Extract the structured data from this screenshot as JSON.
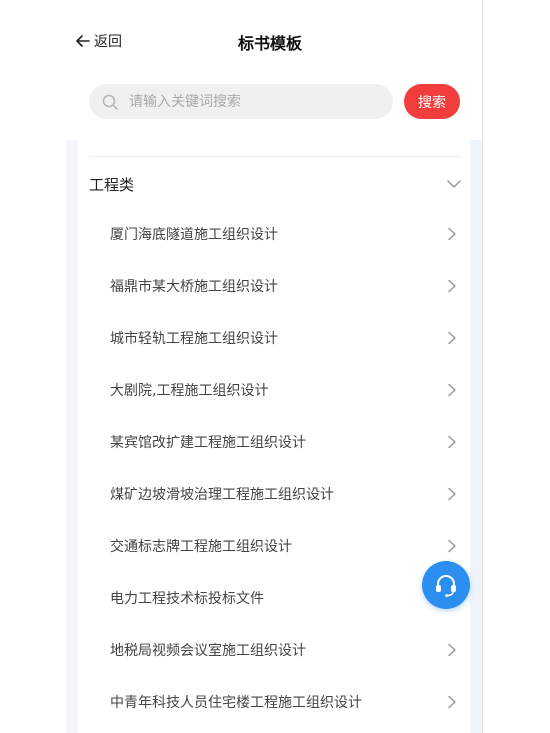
{
  "header": {
    "back_label": "返回",
    "title": "标书模板"
  },
  "search": {
    "placeholder": "请输入关键词搜索",
    "button_label": "搜索"
  },
  "category": {
    "label": "工程类"
  },
  "items": [
    {
      "label": "厦门海底隧道施工组织设计"
    },
    {
      "label": "福鼎市某大桥施工组织设计"
    },
    {
      "label": "城市轻轨工程施工组织设计"
    },
    {
      "label": "大剧院,工程施工组织设计"
    },
    {
      "label": "某宾馆改扩建工程施工组织设计"
    },
    {
      "label": "煤矿边坡滑坡治理工程施工组织设计"
    },
    {
      "label": "交通标志牌工程施工组织设计"
    },
    {
      "label": "电力工程技术标投标文件"
    },
    {
      "label": "地税局视频会议室施工组织设计"
    },
    {
      "label": "中青年科技人员住宅楼工程施工组织设计"
    }
  ],
  "colors": {
    "accent": "#f23d3d",
    "fab": "#2b8ef0"
  }
}
